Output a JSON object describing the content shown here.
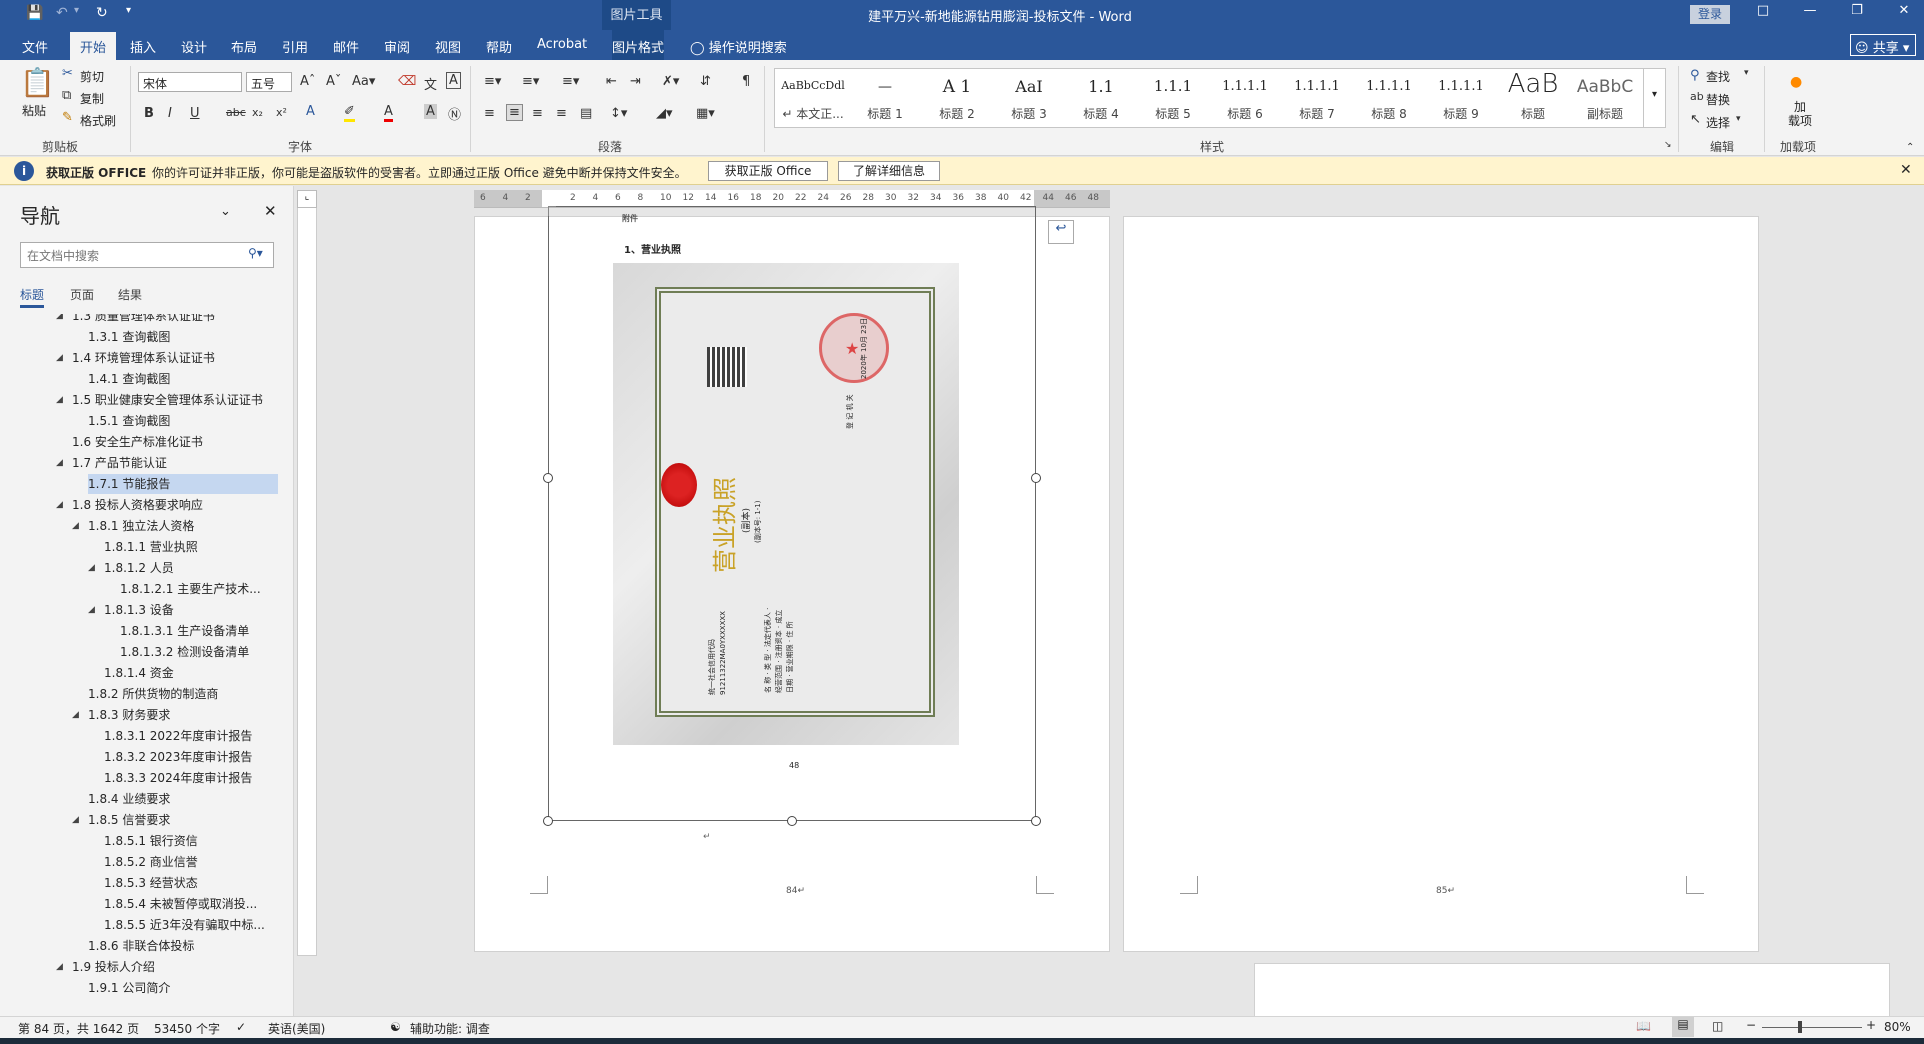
{
  "titlebar": {
    "context_tool": "图片工具",
    "document_title": "建平万兴-新地能源钻用膨润-投标文件  -  Word",
    "login": "登录"
  },
  "tabs": [
    "文件",
    "开始",
    "插入",
    "设计",
    "布局",
    "引用",
    "邮件",
    "审阅",
    "视图",
    "帮助",
    "Acrobat",
    "图片格式"
  ],
  "active_tab": "开始",
  "tell_me": "操作说明搜索",
  "share": "共享",
  "ribbon": {
    "clipboard": {
      "paste": "粘贴",
      "cut": "剪切",
      "copy": "复制",
      "format_painter": "格式刷",
      "label": "剪贴板"
    },
    "font": {
      "font_name": "宋体",
      "font_size": "五号",
      "label": "字体"
    },
    "paragraph": {
      "label": "段落"
    },
    "styles": {
      "label": "样式",
      "items": [
        {
          "preview": "AaBbCcDdl",
          "name": "↵ 本文正..."
        },
        {
          "preview": "—",
          "name": "标题 1"
        },
        {
          "preview": "A 1",
          "name": "标题 2"
        },
        {
          "preview": "AaI",
          "name": "标题 3"
        },
        {
          "preview": "1.1",
          "name": "标题 4"
        },
        {
          "preview": "1.1.1",
          "name": "标题 5"
        },
        {
          "preview": "1.1.1.1",
          "name": "标题 6"
        },
        {
          "preview": "1.1.1.1",
          "name": "标题 7"
        },
        {
          "preview": "1.1.1.1",
          "name": "标题 8"
        },
        {
          "preview": "1.1.1.1",
          "name": "标题 9"
        },
        {
          "preview": "AaB",
          "name": "标题"
        },
        {
          "preview": "AaBbC",
          "name": "副标题"
        }
      ]
    },
    "editing": {
      "find": "查找",
      "replace": "替换",
      "select": "选择",
      "label": "编辑"
    },
    "addins": {
      "button": "加\n载项",
      "label": "加载项"
    }
  },
  "warning": {
    "title": "获取正版 OFFICE",
    "message": "你的许可证并非正版，你可能是盗版软件的受害者。立即通过正版 Office 避免中断并保持文件安全。",
    "btn_get": "获取正版 Office",
    "btn_more": "了解详细信息"
  },
  "nav": {
    "title": "导航",
    "search_placeholder": "在文档中搜索",
    "tabs": [
      "标题",
      "页面",
      "结果"
    ],
    "items": [
      {
        "text": "1.3 质量管理体系认证证书",
        "level": 1,
        "expand": true
      },
      {
        "text": "1.3.1 查询截图",
        "level": 2,
        "expand": false
      },
      {
        "text": "1.4 环境管理体系认证证书",
        "level": 1,
        "expand": true
      },
      {
        "text": "1.4.1 查询截图",
        "level": 2,
        "expand": false
      },
      {
        "text": "1.5 职业健康安全管理体系认证证书",
        "level": 1,
        "expand": true
      },
      {
        "text": "1.5.1 查询截图",
        "level": 2,
        "expand": false
      },
      {
        "text": "1.6 安全生产标准化证书",
        "level": 1,
        "expand": false
      },
      {
        "text": "1.7 产品节能认证",
        "level": 1,
        "expand": true
      },
      {
        "text": "1.7.1 节能报告",
        "level": 2,
        "expand": false,
        "selected": true
      },
      {
        "text": "1.8 投标人资格要求响应",
        "level": 1,
        "expand": true
      },
      {
        "text": "1.8.1 独立法人资格",
        "level": 2,
        "expand": true
      },
      {
        "text": "1.8.1.1 营业执照",
        "level": 3,
        "expand": false
      },
      {
        "text": "1.8.1.2 人员",
        "level": 3,
        "expand": true
      },
      {
        "text": "1.8.1.2.1 主要生产技术...",
        "level": 4,
        "expand": false
      },
      {
        "text": "1.8.1.3 设备",
        "level": 3,
        "expand": true
      },
      {
        "text": "1.8.1.3.1 生产设备清单",
        "level": 4,
        "expand": false
      },
      {
        "text": "1.8.1.3.2 检测设备清单",
        "level": 4,
        "expand": false
      },
      {
        "text": "1.8.1.4 资金",
        "level": 3,
        "expand": false
      },
      {
        "text": "1.8.2 所供货物的制造商",
        "level": 2,
        "expand": false
      },
      {
        "text": "1.8.3 财务要求",
        "level": 2,
        "expand": true
      },
      {
        "text": "1.8.3.1 2022年度审计报告",
        "level": 3,
        "expand": false
      },
      {
        "text": "1.8.3.2 2023年度审计报告",
        "level": 3,
        "expand": false
      },
      {
        "text": "1.8.3.3 2024年度审计报告",
        "level": 3,
        "expand": false
      },
      {
        "text": "1.8.4 业绩要求",
        "level": 2,
        "expand": false
      },
      {
        "text": "1.8.5 信誉要求",
        "level": 2,
        "expand": true
      },
      {
        "text": "1.8.5.1 银行资信",
        "level": 3,
        "expand": false
      },
      {
        "text": "1.8.5.2 商业信誉",
        "level": 3,
        "expand": false
      },
      {
        "text": "1.8.5.3 经营状态",
        "level": 3,
        "expand": false
      },
      {
        "text": "1.8.5.4 未被暂停或取消投...",
        "level": 3,
        "expand": false
      },
      {
        "text": "1.8.5.5 近3年没有骗取中标...",
        "level": 3,
        "expand": false
      },
      {
        "text": "1.8.6 非联合体投标",
        "level": 2,
        "expand": false
      },
      {
        "text": "1.9 投标人介绍",
        "level": 1,
        "expand": true
      },
      {
        "text": "1.9.1 公司简介",
        "level": 2,
        "expand": false
      }
    ]
  },
  "ruler": {
    "ticks": [
      "6",
      "4",
      "2",
      "",
      "2",
      "4",
      "6",
      "8",
      "10",
      "12",
      "14",
      "16",
      "18",
      "20",
      "22",
      "24",
      "26",
      "28",
      "30",
      "32",
      "34",
      "36",
      "38",
      "40",
      "42",
      "44",
      "46",
      "48"
    ]
  },
  "document": {
    "heading_partial": "附件",
    "license_caption": "1、营业执照",
    "license_image": {
      "title": "营业执照",
      "subtitle": "(副本)",
      "copy_no": "(副本号: 1-1)",
      "credit_code_label": "统一社会信用代码",
      "credit_code": "91211322MA0YXXXXXX",
      "fields": [
        "名 称",
        "类 型",
        "法定代表人",
        "经营范围",
        "注册资本",
        "成立日期",
        "营业期限",
        "住 所"
      ],
      "issuer": "登 记 机 关",
      "date": "2020年 10月 23日"
    },
    "inner_page_number": "48",
    "page84_number": "84↵",
    "page85_number": "85↵"
  },
  "statusbar": {
    "page": "第 84 页，共 1642 页",
    "words": "53450 个字",
    "language": "英语(美国)",
    "accessibility": "辅助功能: 调查",
    "zoom": "80%"
  }
}
